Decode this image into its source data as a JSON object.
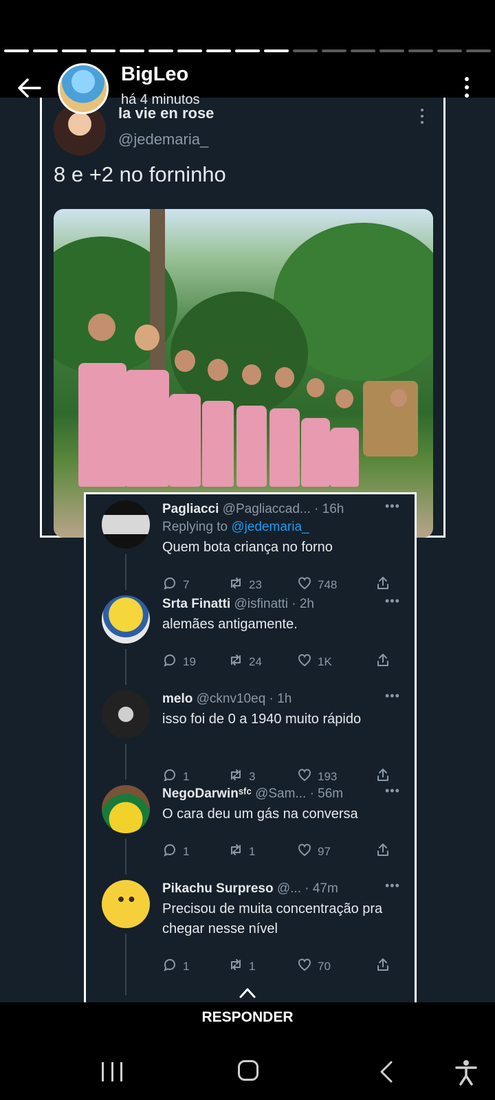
{
  "story": {
    "progress_segments": 17,
    "progress_done": 10,
    "user_name": "BigLeo",
    "time": "há 4 minutos",
    "reply_label": "RESPONDER"
  },
  "tweet": {
    "name": "la vie en rose",
    "handle": "@jedemaria_",
    "text": "8 e +2 no forninho"
  },
  "replies": [
    {
      "name": "Pagliacci",
      "handle": "@Pagliaccad... · 16h",
      "replying_prefix": "Replying to ",
      "replying_handle": "@jedemaria_",
      "text": "Quem bota criança no forno",
      "replies": "7",
      "retweets": "23",
      "likes": "748"
    },
    {
      "name": "Srta Finatti",
      "handle": "@isfinatti · 2h",
      "text": "alemães antigamente.",
      "replies": "19",
      "retweets": "24",
      "likes": "1K"
    },
    {
      "name": "melo",
      "handle": "@cknv10eq · 1h",
      "text": "isso foi de 0 a 1940 muito rápido",
      "replies": "1",
      "retweets": "3",
      "likes": "193"
    },
    {
      "name": "NegoDarwinˢᶠᶜ",
      "handle": "@Sam... · 56m",
      "text": "O cara deu um gás na conversa",
      "replies": "1",
      "retweets": "1",
      "likes": "97"
    },
    {
      "name": "Pikachu Surpreso",
      "handle": "@...    · 47m",
      "text": "Precisou de muita concentração pra chegar nesse nível",
      "replies": "1",
      "retweets": "1",
      "likes": "70"
    }
  ],
  "colors": {
    "bg": "#15202b",
    "muted": "#8b98a5",
    "link": "#1d9bf0"
  }
}
